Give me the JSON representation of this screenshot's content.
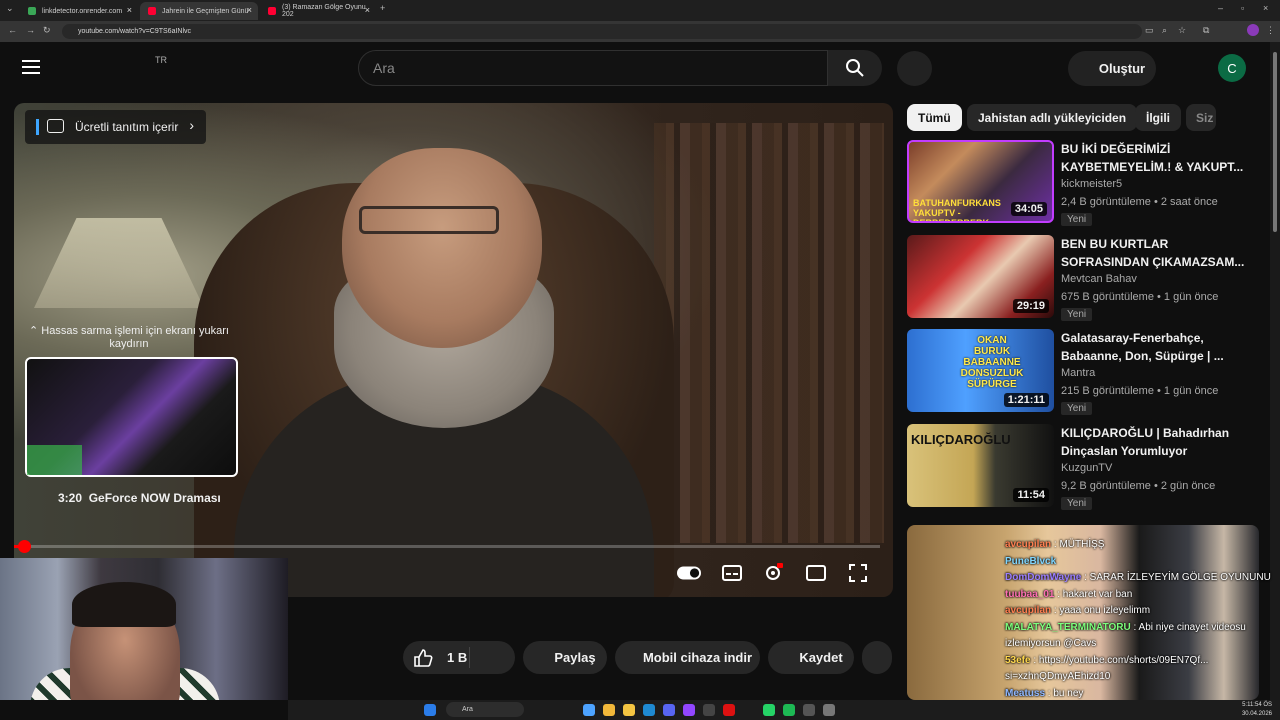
{
  "browser": {
    "tabs": [
      {
        "label": "linkdetector.onrender.com",
        "close": "×"
      },
      {
        "label": "Jahrein ile Geçmişten Günü",
        "close": "×"
      },
      {
        "label": "(3) Ramazan Gölge Oyunu 202",
        "close": "×"
      }
    ],
    "new_tab": "+",
    "url": "youtube.com/watch?v=C9TS6aINlvc"
  },
  "header": {
    "region": "TR",
    "search_placeholder": "Ara",
    "create_label": "Oluştur",
    "avatar_letter": "C"
  },
  "player": {
    "promo_label": "Ücretli tanıtım içerir",
    "promo_chevron": "›",
    "seek_hint": "⌃ Hassas sarma işlemi için ekranı yukarı kaydırın",
    "chapter_time": "3:20",
    "chapter_title": "GeForce NOW Draması",
    "progress_fraction": 0.02
  },
  "actions": {
    "like_count": "1 B",
    "share": "Paylaş",
    "download": "Mobil cihaza indir",
    "save": "Kaydet"
  },
  "sidebar": {
    "chips": [
      "Tümü",
      "Jahistan adlı yükleyiciden",
      "İlgili",
      "Siz"
    ],
    "recommendations": [
      {
        "title": "BU İKİ DEĞERİMİZİ KAYBETMEYELİM.! & YAKUPT...",
        "channel": "kickmeister5",
        "meta": "2,4 B görüntüleme • 2 saat önce",
        "badge": "Yeni",
        "duration": "34:05",
        "thumb_text": "BATUHANFURKANS YAKUPTV - DERBEDERBERK"
      },
      {
        "title": "BEN BU KURTLAR SOFRASINDAN ÇIKAMAZSAM...",
        "channel": "Mevtcan Bahav",
        "meta": "675 B görüntüleme • 1 gün önce",
        "badge": "Yeni",
        "duration": "29:19"
      },
      {
        "title": "Galatasaray-Fenerbahçe, Babaanne, Don, Süpürge | ...",
        "channel": "Mantra",
        "meta": "215 B görüntüleme • 1 gün önce",
        "badge": "Yeni",
        "duration": "1:21:11",
        "thumb_text": "OKAN BURUK BABAANNE DONSUZLUK SÜPÜRGE"
      },
      {
        "title": "KILIÇDAROĞLU | Bahadırhan Dinçaslan Yorumluyor",
        "channel": "KuzgunTV",
        "meta": "9,2 B görüntüleme • 2 gün önce",
        "badge": "Yeni",
        "duration": "11:54",
        "thumb_text": "KILIÇDAROĞLU"
      }
    ]
  },
  "chat": [
    {
      "user": "avcupilan",
      "msg": ": MÜTHİŞŞ",
      "color": "#ff7f50"
    },
    {
      "user": "PuneBlvck",
      "msg": "",
      "color": "#7fd6ff"
    },
    {
      "user": "DomDomWayne",
      "msg": ": SARAR İZLEYEYİM GÖLGE OYUNUNU",
      "color": "#9a7dff"
    },
    {
      "user": "tuubaa_01",
      "msg": ": hakaret var ban",
      "color": "#ff6fb3"
    },
    {
      "user": "avcupilan",
      "msg": ": yaaa onu izleyelimm",
      "color": "#ff7f50"
    },
    {
      "user": "MALATYA_TERMINATORU",
      "msg": ": Abi niye cinayet videosu",
      "color": "#7cff7c"
    },
    {
      "user": "",
      "msg": "izlemiyorsun @Cavs",
      "color": "#ffffff"
    },
    {
      "user": "53efe",
      "msg": ": https://youtube.com/shorts/09EN7Qf...",
      "color": "#ffd84d"
    },
    {
      "user": "",
      "msg": "si=xzhnQDmyAEhizd10",
      "color": "#ffffff"
    },
    {
      "user": "Meatuss",
      "msg": ": bu ney",
      "color": "#8fb8ff"
    },
    {
      "user": "NOWAx67",
      "msg": ": cache oyn cache",
      "color": "#9eff9e"
    }
  ],
  "taskbar": {
    "search_label": "Ara",
    "time": "5:11:54 ÖS",
    "date": "30.04.2026"
  }
}
